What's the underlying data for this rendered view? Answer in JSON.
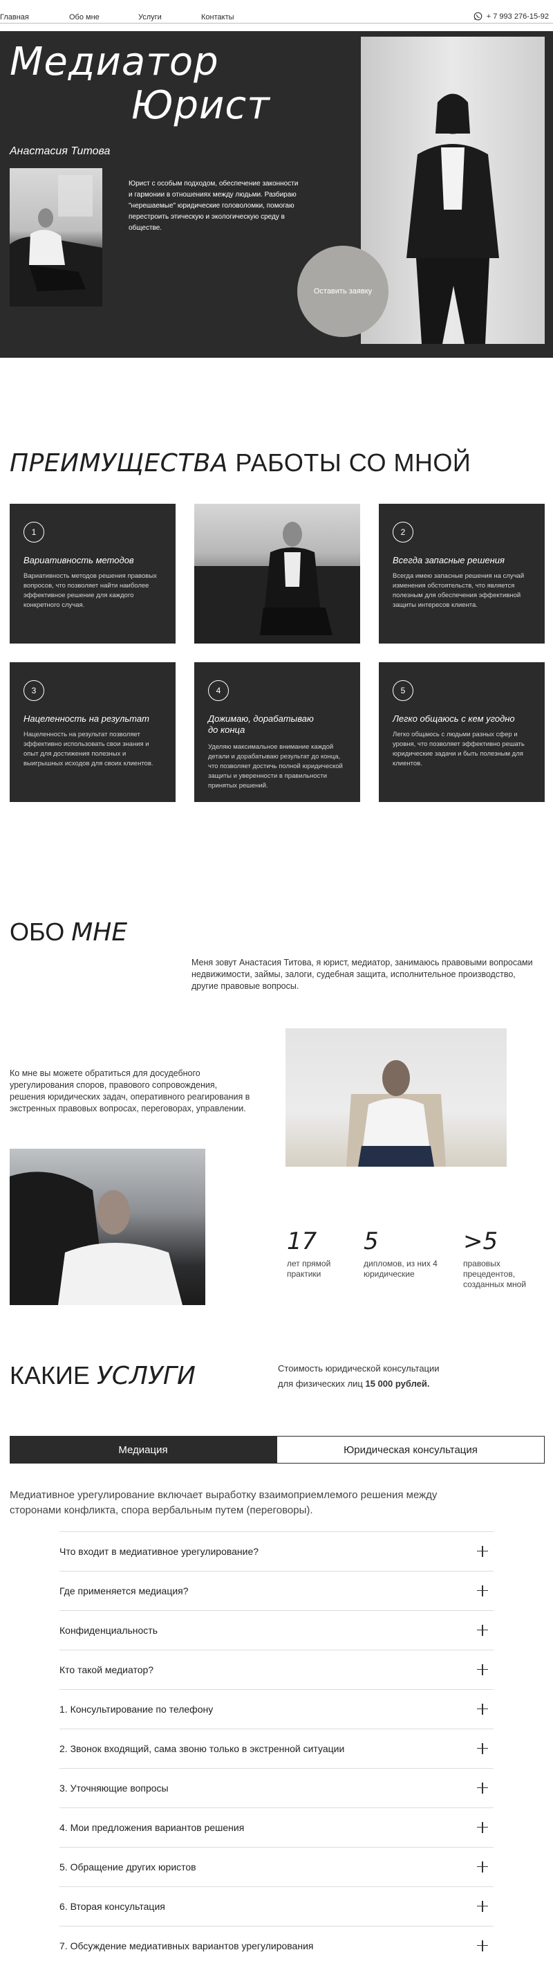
{
  "nav": {
    "items": [
      "Главная",
      "Обо мне",
      "Услуги",
      "Контакты"
    ],
    "phone": "+ 7 993 276-15-92"
  },
  "hero": {
    "title_line1": "Медиатор",
    "title_line2": "Юрист",
    "name": "Анастасия Титова",
    "description": "Юрист с особым подходом, обеспечение законности и гармонии в отношениях между людьми. Разбираю \"нерешаемые\" юридические головоломки, помогаю перестроить этическую и экологическую среду в обществе.",
    "cta": "Оставить заявку"
  },
  "advantages": {
    "title_italic": "ПРЕИМУЩЕСТВА",
    "title_rest": " РАБОТЫ СО МНОЙ",
    "cards": [
      {
        "num": "1",
        "title": "Вариативность методов",
        "text": "Вариативность методов решения правовых вопросов, что позволяет найти наиболее эффективное решение для каждого конкретного случая."
      },
      {
        "num": "2",
        "title": "Всегда запасные решения",
        "text": "Всегда имею запасные решения на случай изменения обстоятельств, что является полезным для обеспечения эффективной защиты интересов клиента."
      },
      {
        "num": "3",
        "title": "Нацеленность на результат",
        "text": "Нацеленность на результат позволяет эффективно использовать свои знания и опыт для достижения полезных и выигрышных исходов для своих клиентов."
      },
      {
        "num": "4",
        "title": "Дожимаю, дорабатываю до конца",
        "text": "Уделяю максимальное внимание каждой детали и дорабатываю результат до конца, что позволяет достичь полной юридической защиты и уверенности в правильности принятых решений."
      },
      {
        "num": "5",
        "title": "Легко общаюсь с кем угодно",
        "text": "Легко общаюсь с людьми разных сфер и уровня, что позволяет эффективно решать юридические задачи и быть полезным для клиентов."
      }
    ]
  },
  "about": {
    "title_plain": "ОБО ",
    "title_italic": "МНЕ",
    "paragraph1": "Меня зовут Анастасия Титова, я юрист, медиатор, занимаюсь правовыми вопросами недвижимости, займы, залоги, судебная защита, исполнительное производство, другие правовые вопросы.",
    "paragraph2": "Ко мне вы можете обратиться для досудебного урегулирования споров, правового сопровождения, решения юридических задач, оперативного реагирования в экстренных правовых вопросах, переговорах, управлении.",
    "stats": [
      {
        "num": "17",
        "text": "лет прямой практики"
      },
      {
        "num": "5",
        "text": "дипломов, из них 4 юридические"
      },
      {
        "num": ">5",
        "text": "правовых прецедентов, созданных мной"
      }
    ]
  },
  "services": {
    "title_plain": "КАКИЕ ",
    "title_italic": "УСЛУГИ",
    "price_line1": "Стоимость юридической консультации",
    "price_line2": "для физических лиц ",
    "price_value": "15 000 рублей.",
    "tabs": [
      "Медиация",
      "Юридическая консультация"
    ],
    "description": "Медиативное урегулирование включает выработку взаимоприемлемого решения между сторонами конфликта, спора вербальным путем (переговоры).",
    "faq": [
      "Что входит в медиативное урегулирование?",
      "Где применяется медиация?",
      "Конфиденциальность",
      "Кто такой медиатор?",
      "1. Консультирование по телефону",
      "2. Звонок входящий, сама звоню только в экстренной ситуации",
      "3. Уточняющие вопросы",
      "4. Мои предложения вариантов решения",
      "5. Обращение других юристов",
      "6. Вторая консультация",
      "7. Обсуждение медиативных вариантов урегулирования"
    ]
  }
}
